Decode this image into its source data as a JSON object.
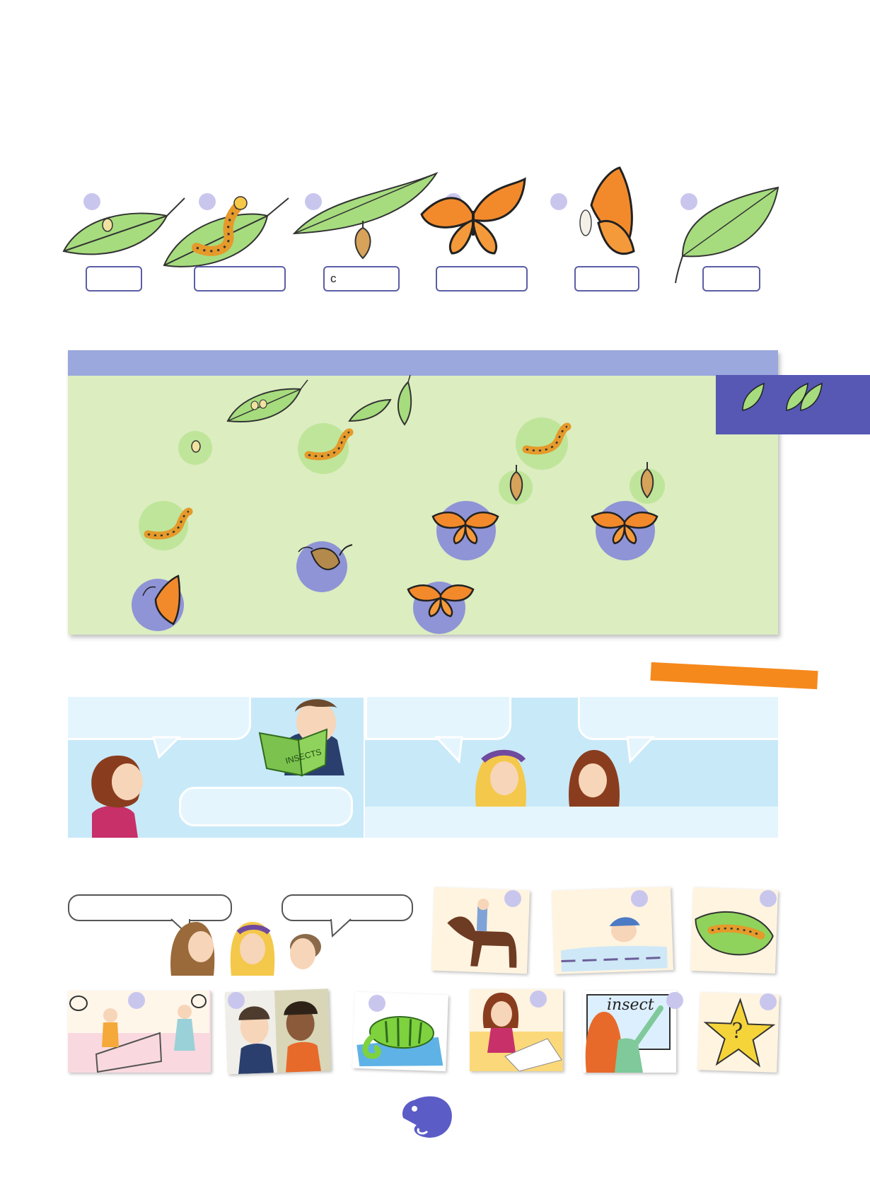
{
  "lifecycle": {
    "answer_boxes": [
      {
        "text": ""
      },
      {
        "text": ""
      },
      {
        "text": "c"
      },
      {
        "text": ""
      },
      {
        "text": ""
      },
      {
        "text": ""
      }
    ]
  },
  "book_cover_text": "INSECTS",
  "whiteboard_text": "insect",
  "star_text": "?",
  "colors": {
    "circle_purple": "#c9c6ee",
    "box_border": "#5b5ea6",
    "game_green": "#dcedc0",
    "game_header": "#9aa8dd",
    "tab_purple": "#5658b4",
    "orange_strip": "#f5891c",
    "panel_blue": "#c8e9f8",
    "mascot_purple": "#5b5cc6"
  },
  "icons": [
    "leaf-icon",
    "egg-icon",
    "caterpillar-icon",
    "chrysalis-icon",
    "butterfly-icon",
    "chameleon-mascot-icon",
    "star-icon"
  ]
}
